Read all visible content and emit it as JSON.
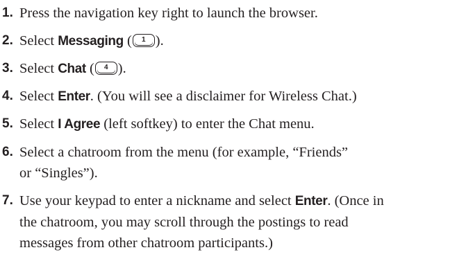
{
  "steps": [
    {
      "number": "1.",
      "lines": [
        {
          "parts": [
            "Press the navigation key right to launch the browser."
          ]
        }
      ]
    },
    {
      "number": "2.",
      "lines": [
        {
          "pre": "Select ",
          "bold": "Messaging",
          "mid": " (",
          "key": "1",
          "post": ")."
        }
      ]
    },
    {
      "number": "3.",
      "lines": [
        {
          "pre": "Select ",
          "bold": "Chat",
          "mid": " (",
          "key": "4",
          "post": ")."
        }
      ]
    },
    {
      "number": "4.",
      "lines": [
        {
          "pre": "Select ",
          "bold": "Enter",
          "post": ". (You will see a disclaimer for Wireless Chat.)"
        }
      ]
    },
    {
      "number": "5.",
      "lines": [
        {
          "pre": "Select ",
          "bold": "I Agree",
          "post": " (left softkey) to enter the Chat menu."
        }
      ]
    },
    {
      "number": "6.",
      "lines": [
        {
          "parts": [
            "Select a chatroom from the menu (for example, “Friends”"
          ]
        },
        {
          "parts": [
            "or “Singles”)."
          ]
        }
      ]
    },
    {
      "number": "7.",
      "lines": [
        {
          "pre": "Use your keypad to enter a nickname and select ",
          "bold": "Enter",
          "post": ". (Once in"
        },
        {
          "parts": [
            "the chatroom, you may scroll through the postings to read"
          ]
        },
        {
          "parts": [
            "messages from other chatroom participants.)"
          ]
        }
      ]
    }
  ]
}
